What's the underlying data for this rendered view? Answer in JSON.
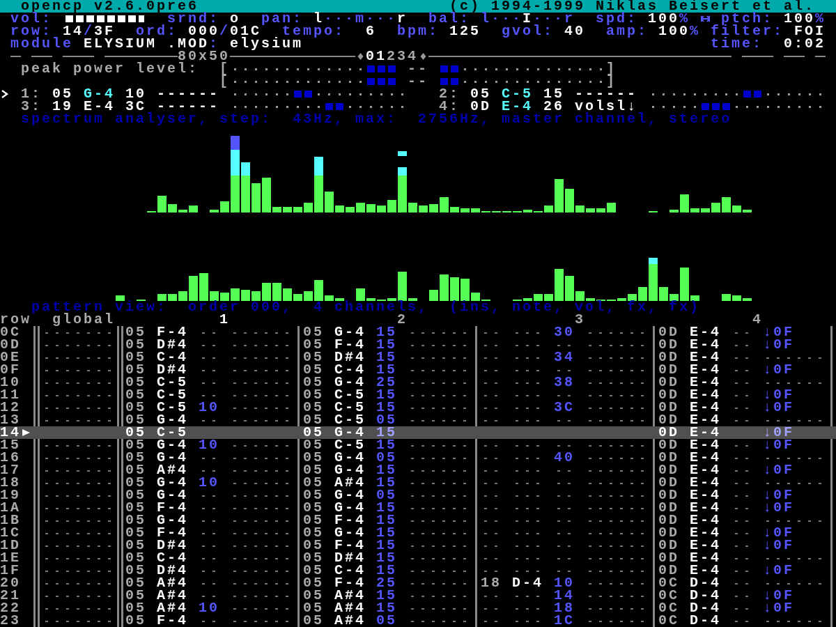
{
  "title_bar": {
    "app": "opencp v2.6.0pre6",
    "copyright": "(c) 1994-1999 Niklas Beisert et al."
  },
  "status_lines": [
    {
      "parts": [
        {
          "kind": "label",
          "text": "vol:"
        },
        {
          "kind": "meter",
          "level": 1
        },
        {
          "kind": "label",
          "text": "srnd:"
        },
        {
          "kind": "value",
          "text": "o"
        },
        {
          "kind": "label",
          "text": "pan:"
        },
        {
          "kind": "value",
          "text": "l"
        },
        {
          "kind": "sep",
          "text": "···m···"
        },
        {
          "kind": "value",
          "text": "r"
        },
        {
          "kind": "label",
          "text": "bal:"
        },
        {
          "kind": "sep",
          "text": "l···"
        },
        {
          "kind": "value",
          "text": "I"
        },
        {
          "kind": "sep",
          "text": "···r"
        },
        {
          "kind": "label",
          "text": "spd:"
        },
        {
          "kind": "value",
          "text": "100"
        },
        {
          "kind": "sep",
          "text": "%"
        },
        {
          "kind": "icon"
        },
        {
          "kind": "label",
          "text": "ptch:"
        },
        {
          "kind": "value",
          "text": "100"
        },
        {
          "kind": "sep",
          "text": "%"
        }
      ]
    },
    {
      "parts": [
        {
          "kind": "label",
          "text": "row:"
        },
        {
          "kind": "value",
          "text": "14"
        },
        {
          "kind": "sep",
          "text": "/"
        },
        {
          "kind": "value",
          "text": "3F"
        },
        {
          "kind": "label",
          "text": "ord:"
        },
        {
          "kind": "value",
          "text": "000"
        },
        {
          "kind": "sep",
          "text": "/"
        },
        {
          "kind": "value",
          "text": "01C"
        },
        {
          "kind": "label",
          "text": "tempo:"
        },
        {
          "kind": "value",
          "text": "6"
        },
        {
          "kind": "label",
          "text": "bpm:"
        },
        {
          "kind": "value",
          "text": "125"
        },
        {
          "kind": "label",
          "text": "gvol:"
        },
        {
          "kind": "value",
          "text": "40"
        },
        {
          "kind": "label",
          "text": "amp:"
        },
        {
          "kind": "value",
          "text": "100"
        },
        {
          "kind": "sep",
          "text": "%"
        },
        {
          "kind": "label",
          "text": "filter:"
        },
        {
          "kind": "value",
          "text": "FOI"
        }
      ]
    },
    {
      "parts": [
        {
          "kind": "label",
          "text": "module"
        },
        {
          "kind": "value",
          "text": "ELYSIUM .MOD"
        },
        {
          "kind": "sep",
          "text": ":"
        },
        {
          "kind": "value",
          "text": "elysium"
        },
        {
          "kind": "label",
          "text": "time:"
        },
        {
          "kind": "value",
          "text": "0:02"
        }
      ]
    }
  ],
  "separator": {
    "mode": "80x50",
    "pages": [
      {
        "text": "0",
        "active": true
      },
      {
        "text": "1",
        "active": true
      },
      {
        "text": "2",
        "active": false
      },
      {
        "text": "3",
        "active": false
      },
      {
        "text": "4",
        "active": false
      }
    ]
  },
  "peak_meters": [
    {
      "label": "peak power level:",
      "open": "[",
      "left_meter": {
        "level": 0.1875
      },
      "center": "--",
      "right_meter": {
        "level": 0.125
      },
      "close": "]"
    },
    {
      "open": "[",
      "left_meter": {
        "level": 0.1875
      },
      "center": "--",
      "right_meter": {
        "level": 0.125
      },
      "close": "]"
    }
  ],
  "channels": [
    {
      "number": "1:",
      "ins": "05",
      "note": "G-4",
      "note_active": true,
      "vol": "10",
      "effect": "------",
      "left_meter": {
        "level": 0.25
      },
      "right_meter": {
        "level": 0
      },
      "selected": true
    },
    {
      "number": "2:",
      "ins": "05",
      "note": "C-5",
      "note_active": true,
      "vol": "15",
      "effect": "------",
      "left_meter": {
        "level": 0
      },
      "right_meter": {
        "level": 0.25
      },
      "selected": false
    },
    {
      "number": "3:",
      "ins": "19",
      "note": "E-4",
      "note_active": false,
      "vol": "3C",
      "effect": "------",
      "left_meter": {
        "level": 0
      },
      "right_meter": {
        "level": 0.25
      },
      "selected": false
    },
    {
      "number": "4:",
      "ins": "0D",
      "note": "E-4",
      "note_active": true,
      "vol": "26",
      "effect": "volsl↓",
      "left_meter": {
        "level": 0.375
      },
      "right_meter": {
        "level": 0
      },
      "selected": false
    }
  ],
  "spectrum_title": "spectrum analyser, step:  43Hz, max:  2756Hz, master channel, stereo",
  "pattern": {
    "title": "pattern view:  order 000,  4 channels,  (ins, note, vol, fx, fx)",
    "row_label": "row",
    "global_label": "global",
    "channels": [
      {
        "label": "1",
        "selected": true
      },
      {
        "label": "2",
        "selected": false
      },
      {
        "label": "3",
        "selected": false
      },
      {
        "label": "4",
        "selected": false
      }
    ],
    "rows": [
      {
        "row": "0C",
        "current": false,
        "cells": [
          {
            "ins": "05",
            "note": "F-4"
          },
          {
            "ins": "05",
            "note": "G-4",
            "vol": "15"
          },
          {
            "vol": "30"
          },
          {
            "ins": "0D",
            "note": "E-4",
            "fx": "↓0F"
          }
        ]
      },
      {
        "row": "0D",
        "current": false,
        "cells": [
          {
            "ins": "05",
            "note": "D#4"
          },
          {
            "ins": "05",
            "note": "F-4",
            "vol": "15"
          },
          {},
          {
            "ins": "0D",
            "note": "E-4",
            "fx": "↓0F"
          }
        ]
      },
      {
        "row": "0E",
        "current": false,
        "cells": [
          {
            "ins": "05",
            "note": "C-4"
          },
          {
            "ins": "05",
            "note": "D#4",
            "vol": "15"
          },
          {
            "vol": "34"
          },
          {
            "ins": "0D",
            "note": "E-4"
          }
        ]
      },
      {
        "row": "0F",
        "current": false,
        "cells": [
          {
            "ins": "05",
            "note": "D#4"
          },
          {
            "ins": "05",
            "note": "C-4",
            "vol": "15"
          },
          {},
          {
            "ins": "0D",
            "note": "E-4",
            "fx": "↓0F"
          }
        ]
      },
      {
        "row": "10",
        "current": false,
        "cells": [
          {
            "ins": "05",
            "note": "C-5"
          },
          {
            "ins": "05",
            "note": "G-4",
            "vol": "25"
          },
          {
            "vol": "38"
          },
          {
            "ins": "0D",
            "note": "E-4"
          }
        ]
      },
      {
        "row": "11",
        "current": false,
        "cells": [
          {
            "ins": "05",
            "note": "C-5"
          },
          {
            "ins": "05",
            "note": "C-5",
            "vol": "15"
          },
          {},
          {
            "ins": "0D",
            "note": "E-4",
            "fx": "↓0F"
          }
        ]
      },
      {
        "row": "12",
        "current": false,
        "cells": [
          {
            "ins": "05",
            "note": "C-5",
            "vol": "10"
          },
          {
            "ins": "05",
            "note": "C-5",
            "vol": "15"
          },
          {
            "vol": "3C"
          },
          {
            "ins": "0D",
            "note": "E-4",
            "fx": "↓0F"
          }
        ]
      },
      {
        "row": "13",
        "current": false,
        "cells": [
          {
            "ins": "05",
            "note": "G-4"
          },
          {
            "ins": "05",
            "note": "C-5",
            "vol": "05"
          },
          {},
          {
            "ins": "0D",
            "note": "E-4"
          }
        ]
      },
      {
        "row": "14",
        "current": true,
        "cells": [
          {
            "ins": "05",
            "note": "C-5"
          },
          {
            "ins": "05",
            "note": "G-4",
            "vol": "15"
          },
          {},
          {
            "ins": "0D",
            "note": "E-4",
            "fx": "↓0F"
          }
        ]
      },
      {
        "row": "15",
        "current": false,
        "cells": [
          {
            "ins": "05",
            "note": "G-4",
            "vol": "10"
          },
          {
            "ins": "05",
            "note": "C-5",
            "vol": "15"
          },
          {},
          {
            "ins": "0D",
            "note": "E-4",
            "fx": "↓0F"
          }
        ]
      },
      {
        "row": "16",
        "current": false,
        "cells": [
          {
            "ins": "05",
            "note": "G-4"
          },
          {
            "ins": "05",
            "note": "G-4",
            "vol": "05"
          },
          {
            "vol": "40"
          },
          {
            "ins": "0D",
            "note": "E-4"
          }
        ]
      },
      {
        "row": "17",
        "current": false,
        "cells": [
          {
            "ins": "05",
            "note": "A#4"
          },
          {
            "ins": "05",
            "note": "G-4",
            "vol": "15"
          },
          {},
          {
            "ins": "0D",
            "note": "E-4",
            "fx": "↓0F"
          }
        ]
      },
      {
        "row": "18",
        "current": false,
        "cells": [
          {
            "ins": "05",
            "note": "G-4",
            "vol": "10"
          },
          {
            "ins": "05",
            "note": "A#4",
            "vol": "15"
          },
          {},
          {
            "ins": "0D",
            "note": "E-4"
          }
        ]
      },
      {
        "row": "19",
        "current": false,
        "cells": [
          {
            "ins": "05",
            "note": "G-4"
          },
          {
            "ins": "05",
            "note": "G-4",
            "vol": "05"
          },
          {},
          {
            "ins": "0D",
            "note": "E-4",
            "fx": "↓0F"
          }
        ]
      },
      {
        "row": "1A",
        "current": false,
        "cells": [
          {
            "ins": "05",
            "note": "F-4"
          },
          {
            "ins": "05",
            "note": "G-4",
            "vol": "15"
          },
          {},
          {
            "ins": "0D",
            "note": "E-4",
            "fx": "↓0F"
          }
        ]
      },
      {
        "row": "1B",
        "current": false,
        "cells": [
          {
            "ins": "05",
            "note": "G-4"
          },
          {
            "ins": "05",
            "note": "F-4",
            "vol": "15"
          },
          {},
          {
            "ins": "0D",
            "note": "E-4"
          }
        ]
      },
      {
        "row": "1C",
        "current": false,
        "cells": [
          {
            "ins": "05",
            "note": "F-4"
          },
          {
            "ins": "05",
            "note": "G-4",
            "vol": "15"
          },
          {},
          {
            "ins": "0D",
            "note": "E-4",
            "fx": "↓0F"
          }
        ]
      },
      {
        "row": "1D",
        "current": false,
        "cells": [
          {
            "ins": "05",
            "note": "D#4"
          },
          {
            "ins": "05",
            "note": "F-4",
            "vol": "15"
          },
          {},
          {
            "ins": "0D",
            "note": "E-4",
            "fx": "↓0F"
          }
        ]
      },
      {
        "row": "1E",
        "current": false,
        "cells": [
          {
            "ins": "05",
            "note": "C-4"
          },
          {
            "ins": "05",
            "note": "D#4",
            "vol": "15"
          },
          {},
          {
            "ins": "0D",
            "note": "E-4"
          }
        ]
      },
      {
        "row": "1F",
        "current": false,
        "cells": [
          {
            "ins": "05",
            "note": "D#4"
          },
          {
            "ins": "05",
            "note": "C-4",
            "vol": "15"
          },
          {},
          {
            "ins": "0D",
            "note": "E-4",
            "fx": "↓0F"
          }
        ]
      },
      {
        "row": "20",
        "current": false,
        "cells": [
          {
            "ins": "05",
            "note": "A#4"
          },
          {
            "ins": "05",
            "note": "F-4",
            "vol": "25"
          },
          {
            "ins": "18",
            "note": "D-4",
            "vol": "10"
          },
          {
            "ins": "0C",
            "note": "D-4"
          }
        ]
      },
      {
        "row": "21",
        "current": false,
        "cells": [
          {
            "ins": "05",
            "note": "A#4"
          },
          {
            "ins": "05",
            "note": "A#4",
            "vol": "15"
          },
          {
            "vol": "14"
          },
          {
            "ins": "0C",
            "note": "D-4",
            "fx": "↓0F"
          }
        ]
      },
      {
        "row": "22",
        "current": false,
        "cells": [
          {
            "ins": "05",
            "note": "A#4",
            "vol": "10"
          },
          {
            "ins": "05",
            "note": "A#4",
            "vol": "15"
          },
          {
            "vol": "18"
          },
          {
            "ins": "0C",
            "note": "D-4",
            "fx": "↓0F"
          }
        ]
      },
      {
        "row": "23",
        "current": false,
        "cells": [
          {
            "ins": "05",
            "note": "F-4"
          },
          {
            "ins": "05",
            "note": "A#4",
            "vol": "05"
          },
          {
            "vol": "1C"
          },
          {
            "ins": "0C",
            "note": "D-4"
          }
        ]
      }
    ]
  }
}
